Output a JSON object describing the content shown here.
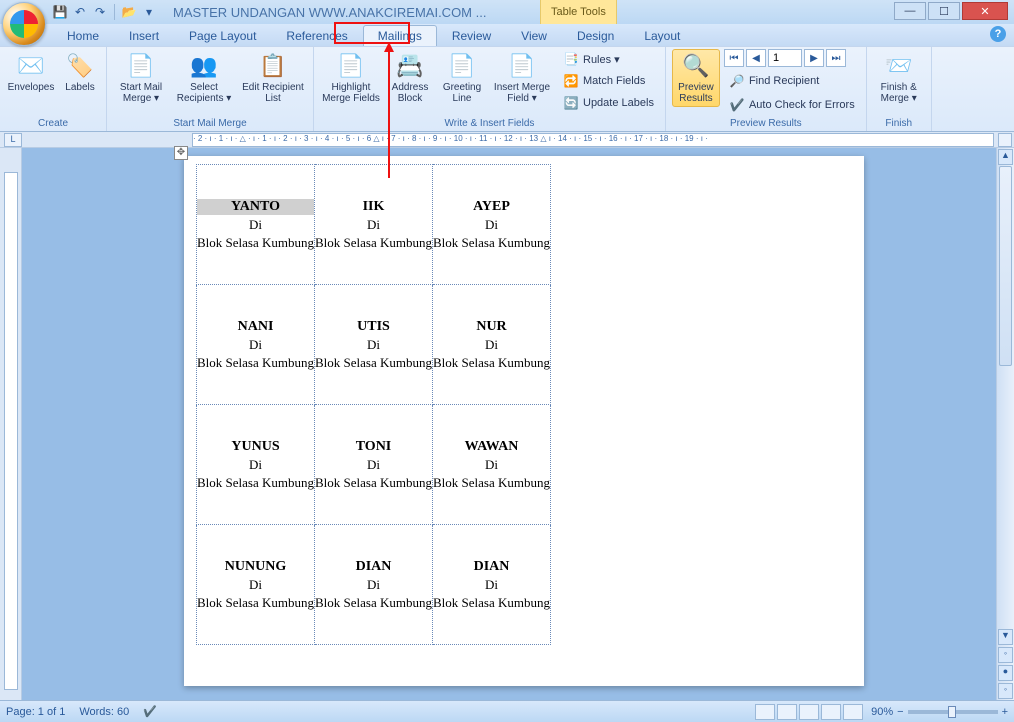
{
  "title": "MASTER UNDANGAN WWW.ANAKCIREMAI.COM ...",
  "table_tools": "Table Tools",
  "qat": {
    "save": "💾",
    "undo": "↶",
    "redo": "↷",
    "open": "📂"
  },
  "window": {
    "min": "—",
    "max": "☐",
    "close": "✕"
  },
  "tabs": {
    "home": "Home",
    "insert": "Insert",
    "pagelayout": "Page Layout",
    "references": "References",
    "mailings": "Mailings",
    "review": "Review",
    "view": "View",
    "design": "Design",
    "layout": "Layout"
  },
  "ribbon": {
    "create": {
      "label": "Create",
      "envelopes": "Envelopes",
      "labels": "Labels"
    },
    "startmm": {
      "label": "Start Mail Merge",
      "start": "Start Mail\nMerge ▾",
      "select": "Select\nRecipients ▾",
      "edit": "Edit\nRecipient List"
    },
    "write": {
      "label": "Write & Insert Fields",
      "highlight": "Highlight\nMerge Fields",
      "address": "Address\nBlock",
      "greeting": "Greeting\nLine",
      "insertf": "Insert Merge\nField ▾",
      "rules": "Rules ▾",
      "match": "Match Fields",
      "update": "Update Labels"
    },
    "preview": {
      "label": "Preview Results",
      "preview": "Preview\nResults",
      "record": "1",
      "find": "Find Recipient",
      "auto": "Auto Check for Errors"
    },
    "finish": {
      "label": "Finish",
      "finish": "Finish &\nMerge ▾"
    }
  },
  "labels": [
    {
      "name": "YANTO",
      "di": "Di",
      "addr": "Blok Selasa Kumbung",
      "hl": true
    },
    {
      "name": "IIK",
      "di": "Di",
      "addr": "Blok Selasa Kumbung"
    },
    {
      "name": "AYEP",
      "di": "Di",
      "addr": "Blok Selasa Kumbung"
    },
    {
      "name": "NANI",
      "di": "Di",
      "addr": "Blok Selasa Kumbung"
    },
    {
      "name": "UTIS",
      "di": "Di",
      "addr": "Blok Selasa Kumbung"
    },
    {
      "name": "NUR",
      "di": "Di",
      "addr": "Blok Selasa Kumbung"
    },
    {
      "name": "YUNUS",
      "di": "Di",
      "addr": "Blok Selasa Kumbung"
    },
    {
      "name": "TONI",
      "di": "Di",
      "addr": "Blok Selasa Kumbung"
    },
    {
      "name": "WAWAN",
      "di": "Di",
      "addr": "Blok Selasa Kumbung"
    },
    {
      "name": "NUNUNG",
      "di": "Di",
      "addr": "Blok Selasa Kumbung"
    },
    {
      "name": "DIAN",
      "di": "Di",
      "addr": "Blok Selasa Kumbung"
    },
    {
      "name": "DIAN",
      "di": "Di",
      "addr": "Blok Selasa Kumbung"
    }
  ],
  "ruler_text": "· 2 · ı · 1 · ı · △ · ı · 1 · ı · 2 · ı · 3 · ı · 4 · ı · 5 · ı · 6 △ ı · 7 · ı · 8 · ı · 9 · ı · 10 · ı · 11 · ı · 12 · ı · 13 △ ı · 14 · ı · 15 · ı · 16 · ı · 17 · ı · 18 · ı · 19 · ı ·",
  "status": {
    "page": "Page: 1 of 1",
    "words": "Words: 60",
    "zoom": "90%",
    "minus": "−",
    "plus": "+"
  }
}
